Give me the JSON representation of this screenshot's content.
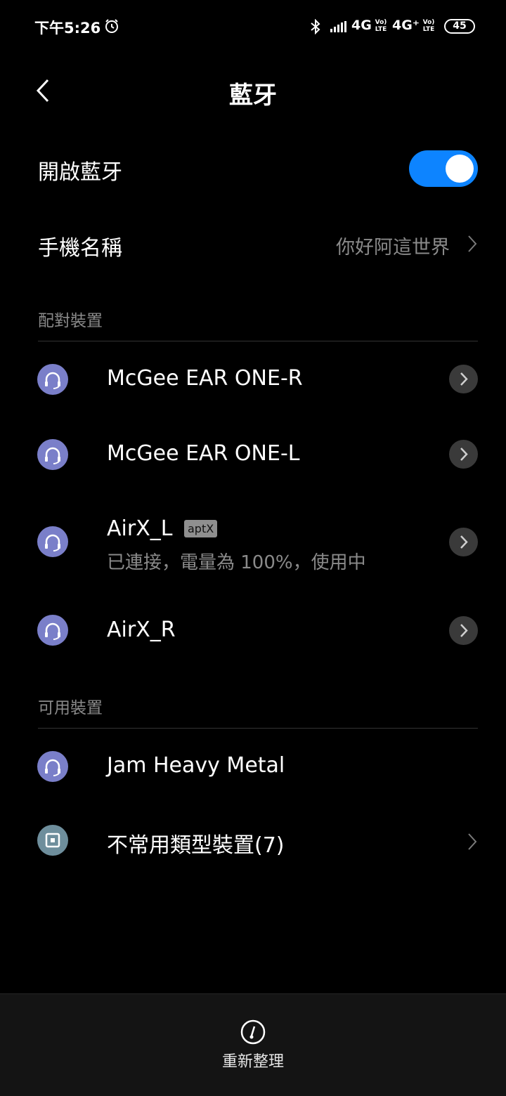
{
  "status_bar": {
    "time": "下午5:26",
    "network1": "4G",
    "network2": "4G⁺",
    "volte_top": "Vo)",
    "volte_bottom": "LTE",
    "battery": "45"
  },
  "header": {
    "title": "藍牙"
  },
  "settings": {
    "bluetooth_label": "開啟藍牙",
    "bluetooth_on": true,
    "phone_name_label": "手機名稱",
    "phone_name_value": "你好阿這世界"
  },
  "paired": {
    "section_title": "配對裝置",
    "devices": [
      {
        "name": "McGee EAR ONE-R",
        "icon": "headset-icon"
      },
      {
        "name": "McGee EAR ONE-L",
        "icon": "headset-icon"
      },
      {
        "name": "AirX_L",
        "badge": "aptX",
        "status": "已連接，電量為 100%，使用中",
        "icon": "headset-icon"
      },
      {
        "name": "AirX_R",
        "icon": "headset-icon"
      }
    ]
  },
  "available": {
    "section_title": "可用裝置",
    "devices": [
      {
        "name": "Jam Heavy Metal",
        "icon": "headset-icon"
      },
      {
        "name": "不常用類型裝置(7)",
        "icon": "device-icon"
      }
    ]
  },
  "bottom_bar": {
    "refresh_label": "重新整理"
  },
  "colors": {
    "accent": "#0d84ff",
    "headset_icon_bg": "#7a7fc9",
    "other_icon_bg": "#6e8e9c"
  }
}
